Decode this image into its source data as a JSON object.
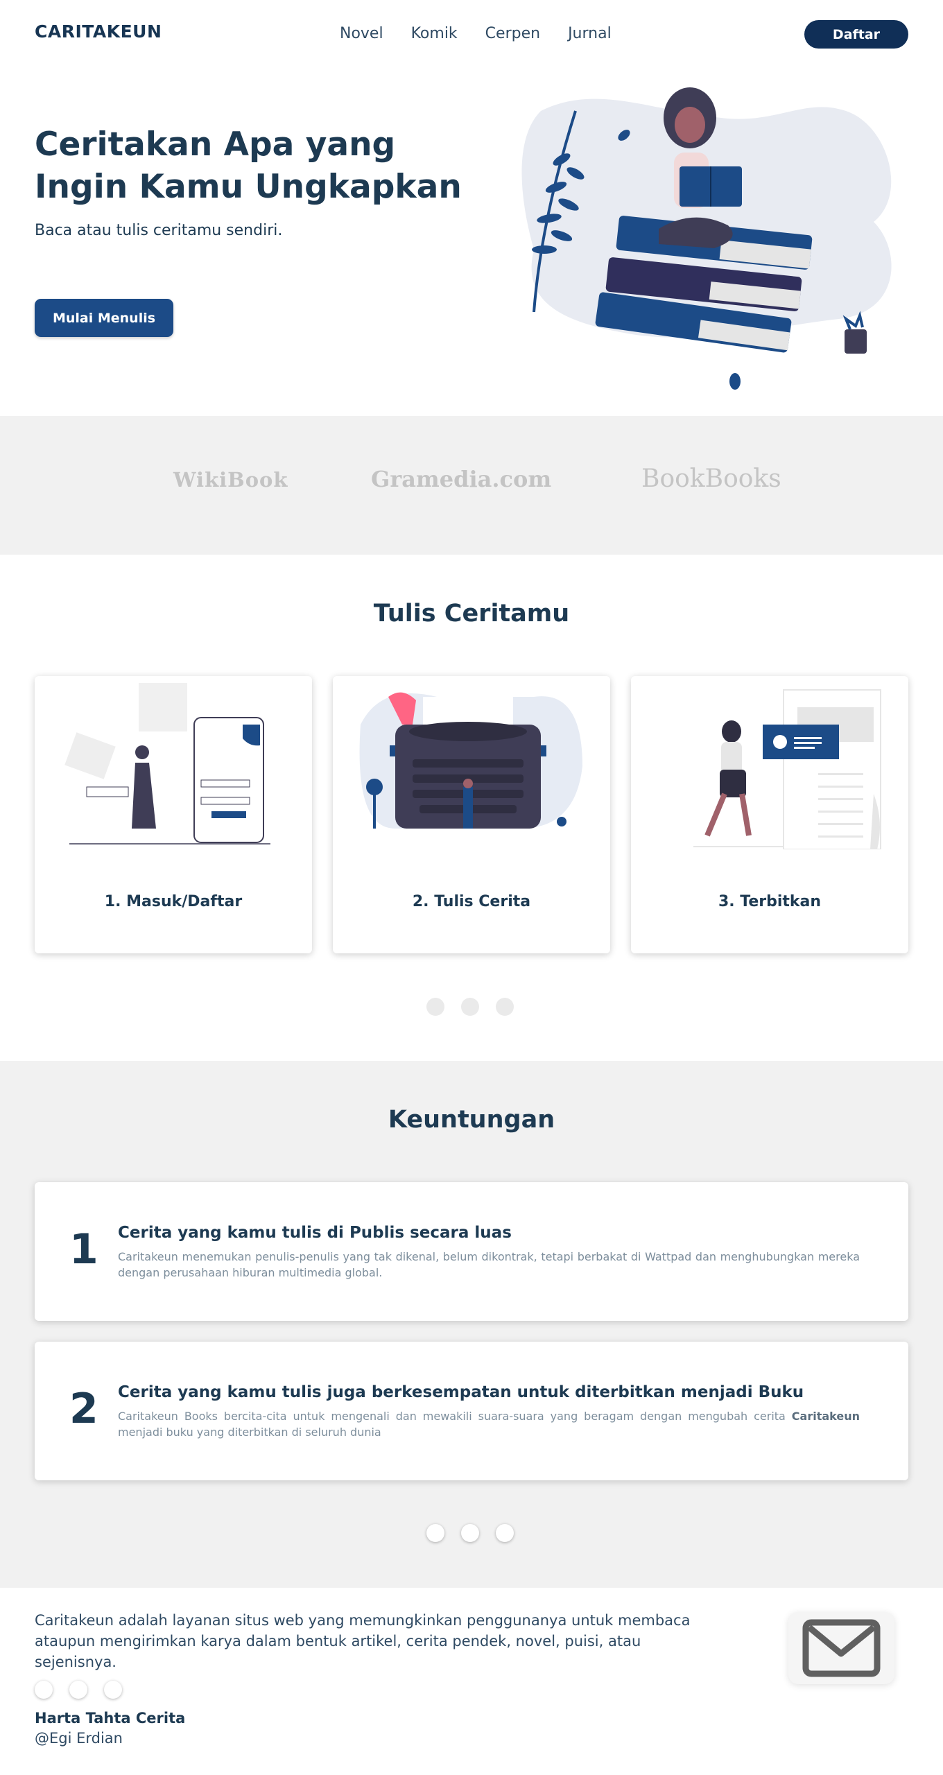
{
  "header": {
    "brand": "CARITAKEUN",
    "nav": [
      "Novel",
      "Komik",
      "Cerpen",
      "Jurnal"
    ],
    "cta": "Daftar"
  },
  "hero": {
    "title": "Ceritakan Apa yang Ingin Kamu Ungkapkan",
    "subtitle": "Baca atau tulis ceritamu sendiri.",
    "button": "Mulai Menulis"
  },
  "partners": [
    "WikiBook",
    "Gramedia.com",
    "BookBooks"
  ],
  "steps": {
    "title": "Tulis Ceritamu",
    "cards": [
      {
        "label": "1. Masuk/Daftar",
        "icon": "login-illustration"
      },
      {
        "label": "2. Tulis Cerita",
        "icon": "typewriter-illustration"
      },
      {
        "label": "3. Terbitkan",
        "icon": "publish-illustration"
      }
    ]
  },
  "benefits": {
    "title": "Keuntungan",
    "items": [
      {
        "number": "1",
        "title": "Cerita yang kamu tulis di Publis secara luas",
        "desc": "Caritakeun menemukan penulis-penulis yang tak dikenal, belum dikontrak, tetapi  berbakat di Wattpad dan menghubungkan mereka dengan perusahaan hiburan multimedia global."
      },
      {
        "number": "2",
        "title": "Cerita yang kamu tulis juga berkesempatan untuk diterbitkan menjadi Buku",
        "desc_before": "Caritakeun Books bercita-cita untuk mengenali dan mewakili suara-suara yang beragam dengan mengubah cerita ",
        "desc_bold": "Caritakeun",
        "desc_after": " menjadi buku yang diterbitkan di seluruh dunia"
      }
    ]
  },
  "footer": {
    "about": "Caritakeun adalah layanan situs web yang memungkinkan penggunanya untuk membaca ataupun mengirimkan karya dalam bentuk artikel, cerita pendek, novel, puisi, atau sejenisnya.",
    "name": "Harta Tahta Cerita",
    "user": "@Egi Erdian",
    "mail_icon": "mail-icon"
  },
  "colors": {
    "primary": "#1c4b87",
    "dark": "#102f57",
    "text": "#1d3a52",
    "section_bg": "#f1f1f1"
  }
}
